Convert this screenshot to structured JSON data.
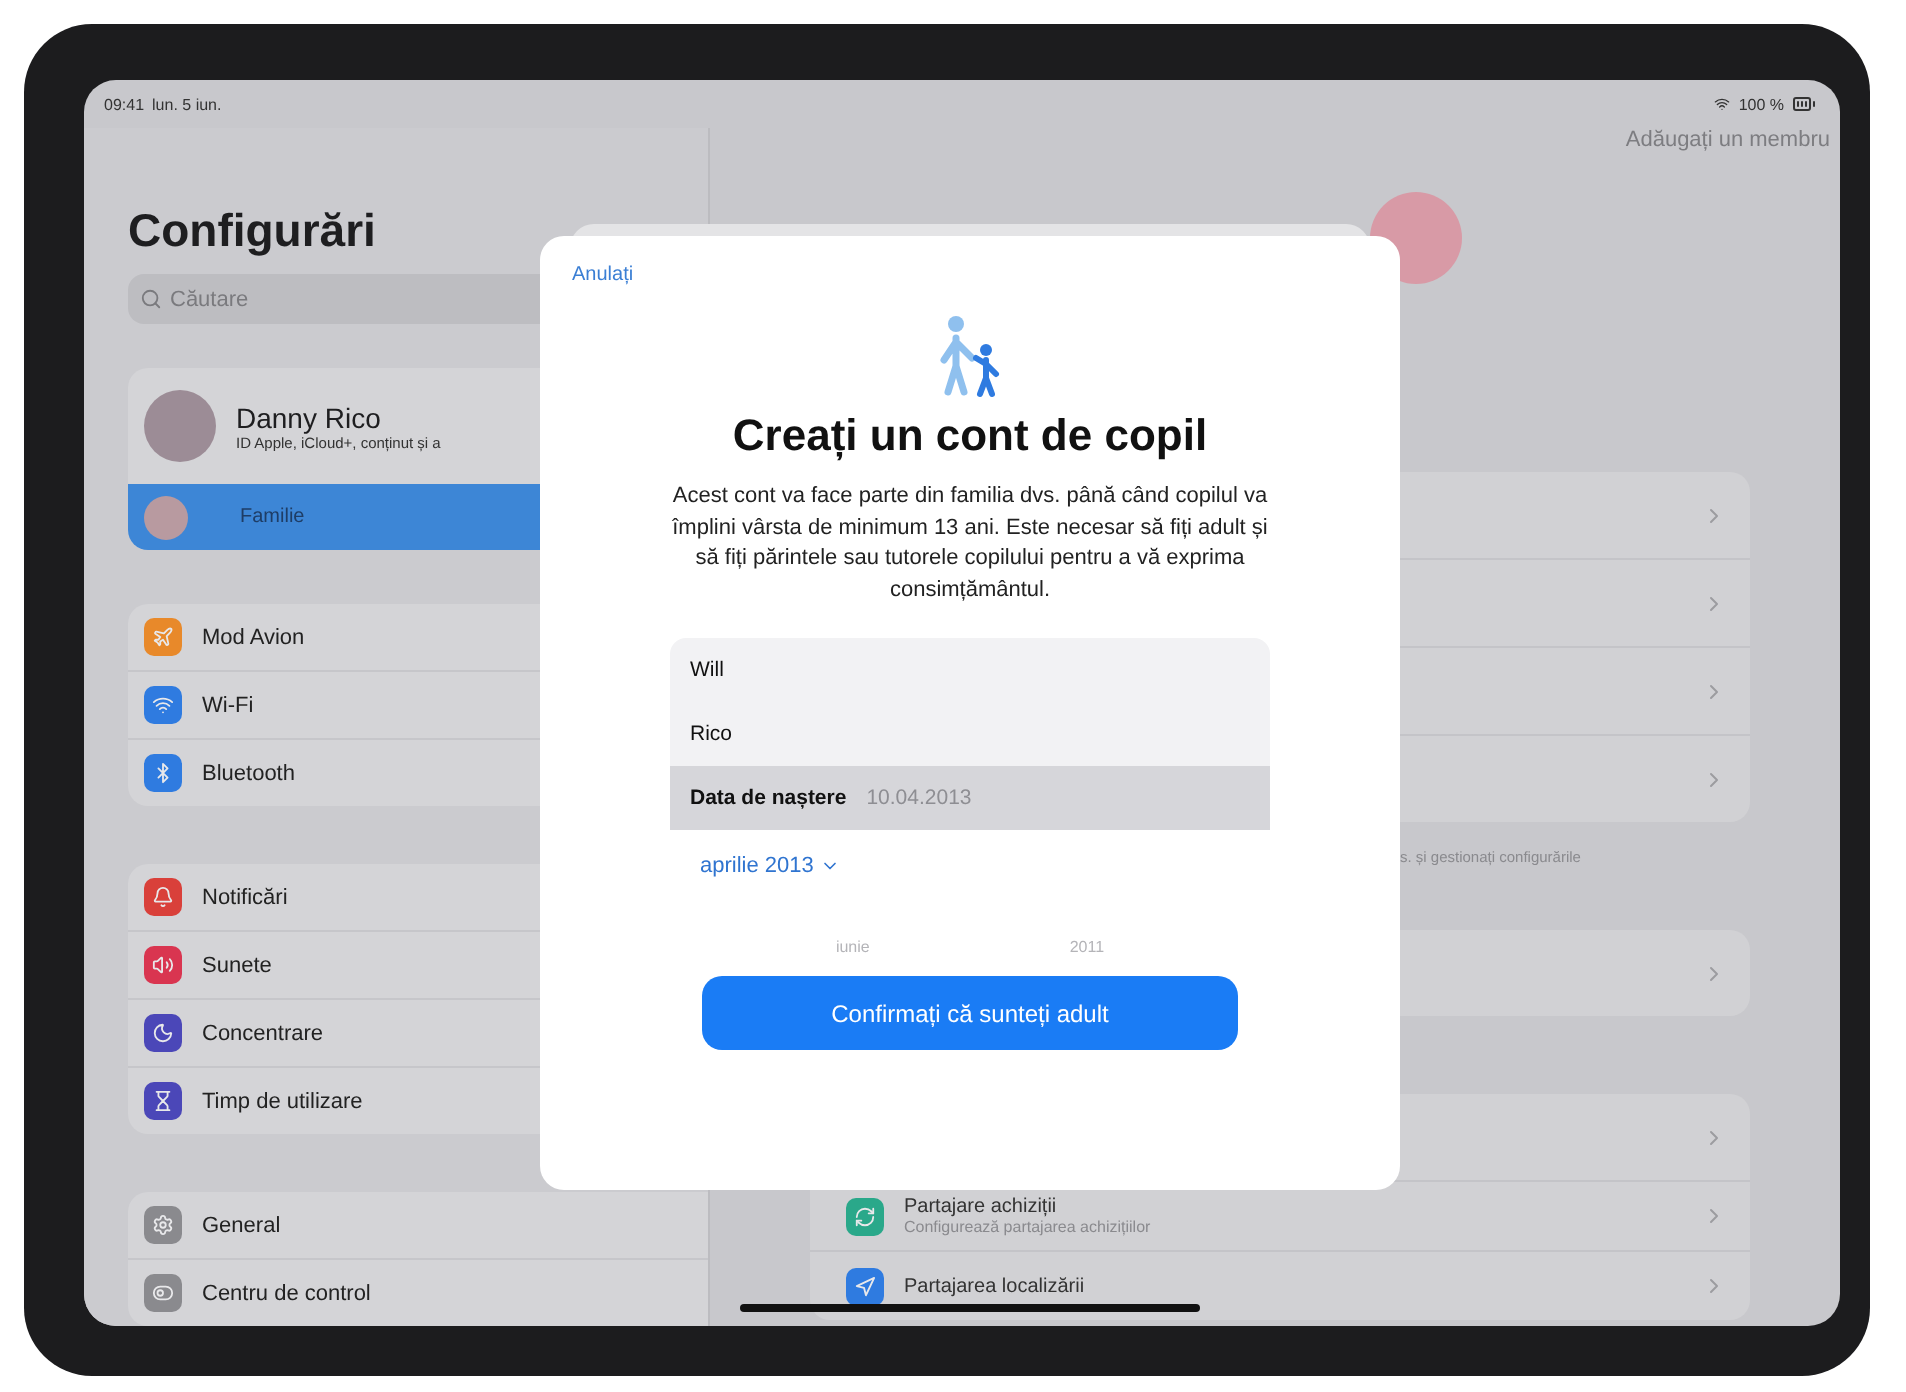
{
  "status_bar": {
    "time": "09:41",
    "date": "lun. 5 iun.",
    "battery": "100 %"
  },
  "sidebar": {
    "title": "Configurări",
    "search": {
      "placeholder": "Căutare"
    },
    "profile": {
      "name": "Danny Rico",
      "subtitle": "ID Apple, iCloud+, conținut și a"
    },
    "family": {
      "label": "Familie",
      "selected": true
    },
    "groups": [
      [
        {
          "label": "Mod Avion",
          "color": "#e8892a"
        },
        {
          "label": "Wi-Fi",
          "color": "#2f7be0"
        },
        {
          "label": "Bluetooth",
          "color": "#2f7be0"
        }
      ],
      [
        {
          "label": "Notificări",
          "color": "#d9403a"
        },
        {
          "label": "Sunete",
          "color": "#d93550"
        },
        {
          "label": "Concentrare",
          "color": "#4b47b8"
        },
        {
          "label": "Timp de utilizare",
          "color": "#4b47b8"
        }
      ],
      [
        {
          "label": "General",
          "color": "#8a8a8e"
        },
        {
          "label": "Centru de control",
          "color": "#8a8a8e"
        }
      ]
    ]
  },
  "detail": {
    "action": "Adăugați un membru",
    "cards": [
      {
        "rows": [
          {
            "kind": "blank"
          },
          {
            "kind": "blank"
          },
          {
            "kind": "blank"
          },
          {
            "kind": "blank"
          }
        ],
        "footer": "s. și gestionați configurările"
      },
      {
        "rows": [
          {
            "kind": "blank"
          }
        ]
      },
      {
        "rows": [
          {
            "kind": "blank"
          },
          {
            "kind": "item",
            "title": "Partajare achiziții",
            "subtitle": "Configurează partajarea achizițiilor",
            "color": "#2aa88a"
          },
          {
            "kind": "item",
            "title": "Partajarea localizării",
            "color": "#2f7be0"
          }
        ]
      }
    ]
  },
  "modal": {
    "cancel": "Anulați",
    "title": "Creați un cont de copil",
    "description": "Acest cont va face parte din familia dvs. până când copilul va împlini vârsta de minimum 13 ani. Este necesar să fiți adult și să fiți părintele sau tutorele copilului pentru a vă exprima consimțământul.",
    "fields": [
      {
        "value": "Will",
        "selected": false
      },
      {
        "value": "Rico",
        "selected": false
      },
      {
        "label": "Data de naștere",
        "value": "10.04.2013",
        "selected": true
      }
    ],
    "month_picker": "aprilie 2013",
    "wheel": [
      "iunie",
      "2011"
    ],
    "button": "Confirmați că sunteți adult"
  }
}
